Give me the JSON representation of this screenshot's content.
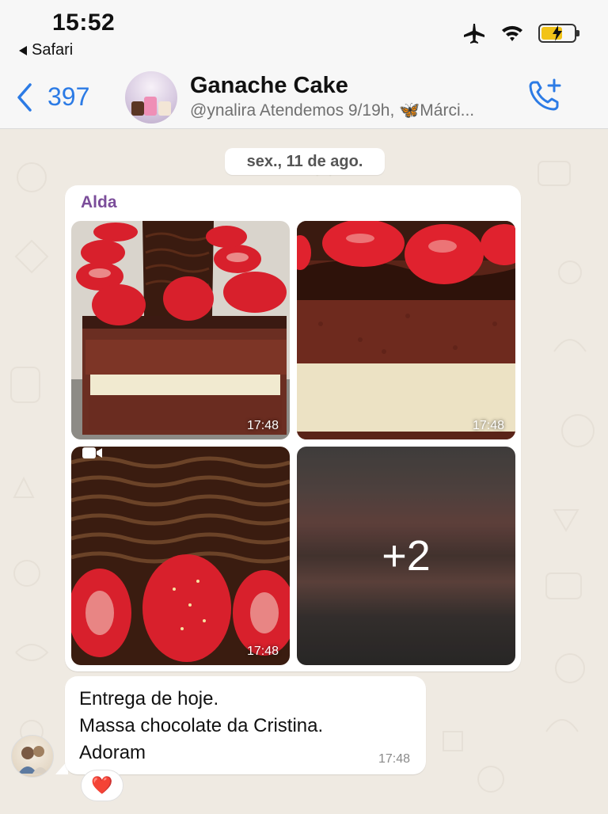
{
  "status_bar": {
    "time": "15:52",
    "back_app_label": "Safari",
    "icons": [
      "airplane-icon",
      "wifi-icon",
      "battery-charging-icon"
    ]
  },
  "header": {
    "back_count": "397",
    "title": "Ganache Cake",
    "subtitle": "@ynalira Atendemos 9/19h, 🦋Márci...",
    "call_icon": "add-call-icon",
    "accent_color": "#2c7be5"
  },
  "chat": {
    "date_separator": "sex., 11 de ago.",
    "album": {
      "sender": "Alda",
      "sender_color": "#7b4d9a",
      "photos": [
        {
          "subject": "layered chocolate cake with strawberries",
          "timestamp": "17:48",
          "is_video": false
        },
        {
          "subject": "close-up of cake slice with strawberries",
          "timestamp": "17:48",
          "is_video": false
        },
        {
          "subject": "chocolate ganache top with strawberries",
          "timestamp": "17:48",
          "is_video": true
        },
        {
          "subject": "blurred cake photo",
          "more_count": "+2"
        }
      ]
    },
    "text_message": {
      "lines": [
        "Entrega de hoje.",
        "Massa chocolate da Cristina.",
        "Adoram"
      ],
      "timestamp": "17:48",
      "reaction": "❤️"
    }
  }
}
